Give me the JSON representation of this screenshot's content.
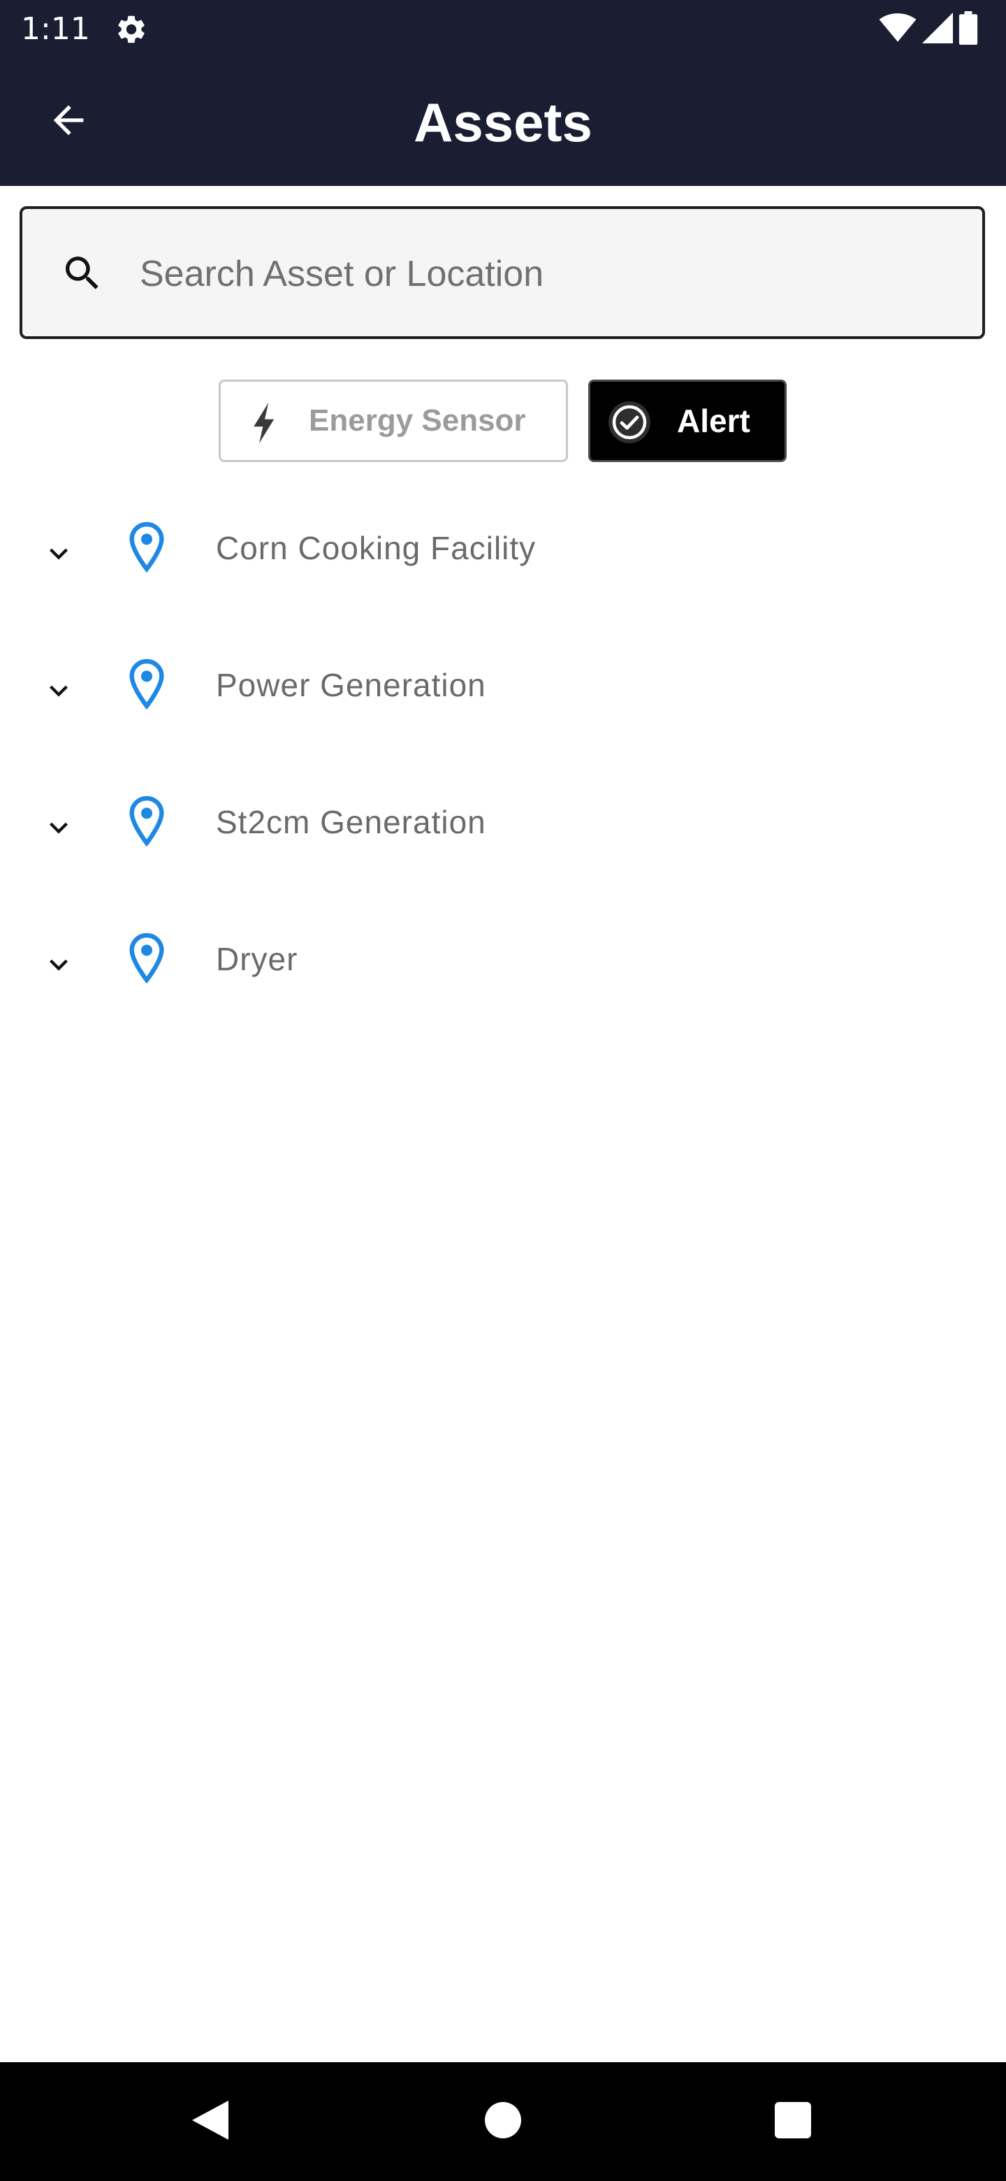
{
  "status_bar": {
    "time": "1:11",
    "icons": [
      "gear-icon",
      "wifi-icon",
      "signal-icon",
      "battery-icon"
    ]
  },
  "app_bar": {
    "title": "Assets",
    "back_icon": "arrow-left-icon"
  },
  "search": {
    "placeholder": "Search Asset or Location",
    "value": "",
    "icon": "search-icon"
  },
  "filters": [
    {
      "label": "Energy Sensor",
      "icon": "bolt-icon",
      "selected": false
    },
    {
      "label": "Alert",
      "icon": "check-circle-icon",
      "selected": true
    }
  ],
  "assets": [
    {
      "name": "Corn Cooking Facility",
      "icon": "location-pin-icon",
      "expand_icon": "chevron-down-icon"
    },
    {
      "name": "Power Generation",
      "icon": "location-pin-icon",
      "expand_icon": "chevron-down-icon"
    },
    {
      "name": "St2cm Generation",
      "icon": "location-pin-icon",
      "expand_icon": "chevron-down-icon"
    },
    {
      "name": "Dryer",
      "icon": "location-pin-icon",
      "expand_icon": "chevron-down-icon"
    }
  ],
  "nav_bar": {
    "buttons": [
      "back-triangle-icon",
      "home-circle-icon",
      "recents-square-icon"
    ]
  },
  "colors": {
    "header_bg": "#1b1d33",
    "pin_blue": "#1e88e5",
    "alert_chip_bg": "#000000",
    "nav_bg": "#000000"
  }
}
